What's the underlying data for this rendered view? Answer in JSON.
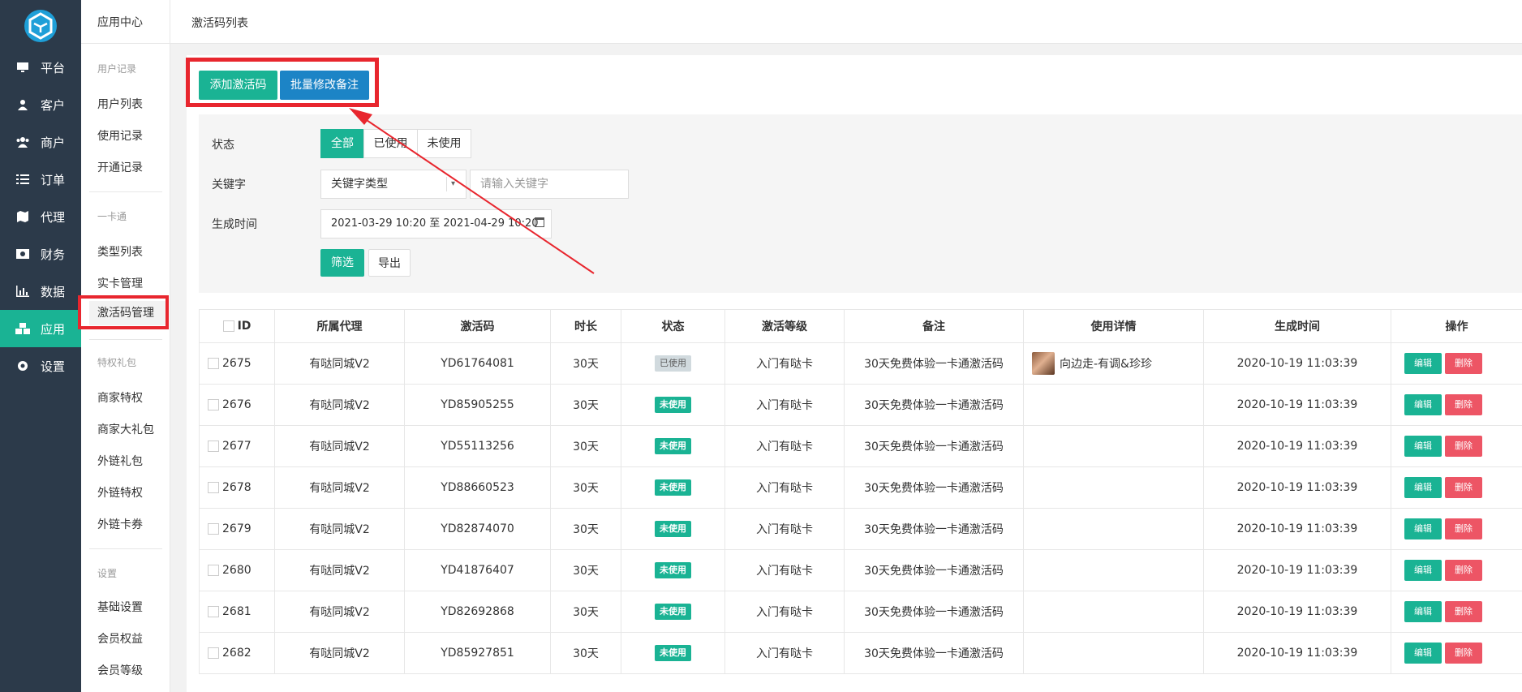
{
  "nav": {
    "items": [
      {
        "label": "平台",
        "icon": "monitor-icon"
      },
      {
        "label": "客户",
        "icon": "user-icon"
      },
      {
        "label": "商户",
        "icon": "users-icon"
      },
      {
        "label": "订单",
        "icon": "list-icon"
      },
      {
        "label": "代理",
        "icon": "map-icon"
      },
      {
        "label": "财务",
        "icon": "money-icon"
      },
      {
        "label": "数据",
        "icon": "bar-chart-icon"
      },
      {
        "label": "应用",
        "icon": "cubes-icon"
      },
      {
        "label": "设置",
        "icon": "gear-icon"
      }
    ],
    "active": "应用",
    "accent_color": "#1ab394"
  },
  "subnav": {
    "title": "应用中心",
    "groups": [
      {
        "title": "用户记录",
        "items": [
          "用户列表",
          "使用记录",
          "开通记录"
        ]
      },
      {
        "title": "一卡通",
        "items": [
          "类型列表",
          "实卡管理",
          "激活码管理"
        ]
      },
      {
        "title": "特权礼包",
        "items": [
          "商家特权",
          "商家大礼包",
          "外链礼包",
          "外链特权",
          "外链卡券"
        ]
      },
      {
        "title": "设置",
        "items": [
          "基础设置",
          "会员权益",
          "会员等级"
        ]
      }
    ],
    "active": "激活码管理"
  },
  "header": {
    "title": "激活码列表"
  },
  "toolbar": {
    "add_label": "添加激活码",
    "batch_label": "批量修改备注"
  },
  "filter": {
    "status_label": "状态",
    "status_options": [
      "全部",
      "已使用",
      "未使用"
    ],
    "status_selected": "全部",
    "keyword_label": "关键字",
    "keyword_type": "关键字类型",
    "keyword_placeholder": "请输入关键字",
    "time_label": "生成时间",
    "time_range": "2021-03-29 10:20 至 2021-04-29 10:20",
    "filter_button": "筛选",
    "export_button": "导出"
  },
  "table": {
    "columns": [
      "ID",
      "所属代理",
      "激活码",
      "时长",
      "状态",
      "激活等级",
      "备注",
      "使用详情",
      "生成时间",
      "操作"
    ],
    "rows": [
      {
        "id": "2675",
        "agent": "有哒同城V2",
        "code": "YD61764081",
        "duration": "30天",
        "status": "已使用",
        "level": "入门有哒卡",
        "note": "30天免费体验一卡通激活码",
        "detail": "向边走-有调&珍珍",
        "created": "2020-10-19 11:03:39"
      },
      {
        "id": "2676",
        "agent": "有哒同城V2",
        "code": "YD85905255",
        "duration": "30天",
        "status": "未使用",
        "level": "入门有哒卡",
        "note": "30天免费体验一卡通激活码",
        "detail": "",
        "created": "2020-10-19 11:03:39"
      },
      {
        "id": "2677",
        "agent": "有哒同城V2",
        "code": "YD55113256",
        "duration": "30天",
        "status": "未使用",
        "level": "入门有哒卡",
        "note": "30天免费体验一卡通激活码",
        "detail": "",
        "created": "2020-10-19 11:03:39"
      },
      {
        "id": "2678",
        "agent": "有哒同城V2",
        "code": "YD88660523",
        "duration": "30天",
        "status": "未使用",
        "level": "入门有哒卡",
        "note": "30天免费体验一卡通激活码",
        "detail": "",
        "created": "2020-10-19 11:03:39"
      },
      {
        "id": "2679",
        "agent": "有哒同城V2",
        "code": "YD82874070",
        "duration": "30天",
        "status": "未使用",
        "level": "入门有哒卡",
        "note": "30天免费体验一卡通激活码",
        "detail": "",
        "created": "2020-10-19 11:03:39"
      },
      {
        "id": "2680",
        "agent": "有哒同城V2",
        "code": "YD41876407",
        "duration": "30天",
        "status": "未使用",
        "level": "入门有哒卡",
        "note": "30天免费体验一卡通激活码",
        "detail": "",
        "created": "2020-10-19 11:03:39"
      },
      {
        "id": "2681",
        "agent": "有哒同城V2",
        "code": "YD82692868",
        "duration": "30天",
        "status": "未使用",
        "level": "入门有哒卡",
        "note": "30天免费体验一卡通激活码",
        "detail": "",
        "created": "2020-10-19 11:03:39"
      },
      {
        "id": "2682",
        "agent": "有哒同城V2",
        "code": "YD85927851",
        "duration": "30天",
        "status": "未使用",
        "level": "入门有哒卡",
        "note": "30天免费体验一卡通激活码",
        "detail": "",
        "created": "2020-10-19 11:03:39"
      }
    ],
    "edit_label": "编辑",
    "delete_label": "删除"
  },
  "colors": {
    "annotation": "#e8262e",
    "edit": "#1ab394",
    "delete": "#ed5565",
    "primary": "#1c84c6"
  }
}
